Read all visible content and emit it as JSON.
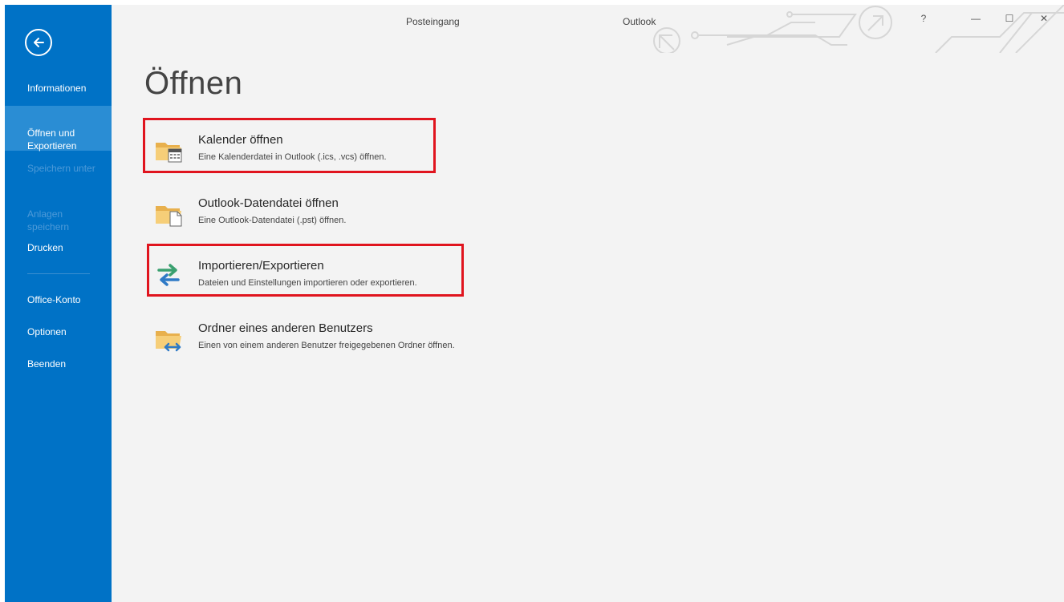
{
  "window": {
    "title": "Posteingang",
    "app_name": "Outlook",
    "help_label": "?",
    "minimize_label": "—",
    "maximize_label": "☐",
    "close_label": "✕"
  },
  "sidebar": {
    "back_icon": "back-arrow-icon",
    "items": [
      {
        "label": "Informationen"
      },
      {
        "label": "Öffnen und\nExportieren"
      },
      {
        "label": "Speichern unter"
      },
      {
        "label": "Anlagen\nspeichern"
      },
      {
        "label": "Drucken"
      },
      {
        "label": "Office-Konto"
      },
      {
        "label": "Optionen"
      },
      {
        "label": "Beenden"
      }
    ]
  },
  "main": {
    "title": "Öffnen",
    "options": [
      {
        "title": "Kalender öffnen",
        "description": "Eine Kalenderdatei in Outlook (.ics, .vcs) öffnen.",
        "icon": "calendar-folder-icon"
      },
      {
        "title": "Outlook-Datendatei öffnen",
        "description": "Eine Outlook-Datendatei (.pst) öffnen.",
        "icon": "data-file-folder-icon"
      },
      {
        "title": "Importieren/Exportieren",
        "description": "Dateien und Einstellungen importieren oder exportieren.",
        "icon": "import-export-icon"
      },
      {
        "title": "Ordner eines anderen Benutzers",
        "description": "Einen von einem anderen Benutzer freigegebenen Ordner öffnen.",
        "icon": "shared-folder-icon"
      }
    ]
  },
  "colors": {
    "sidebar": "#0072c6",
    "sidebar_active": "#2a8dd4",
    "highlight": "#e0141e",
    "background": "#f3f3f3"
  }
}
